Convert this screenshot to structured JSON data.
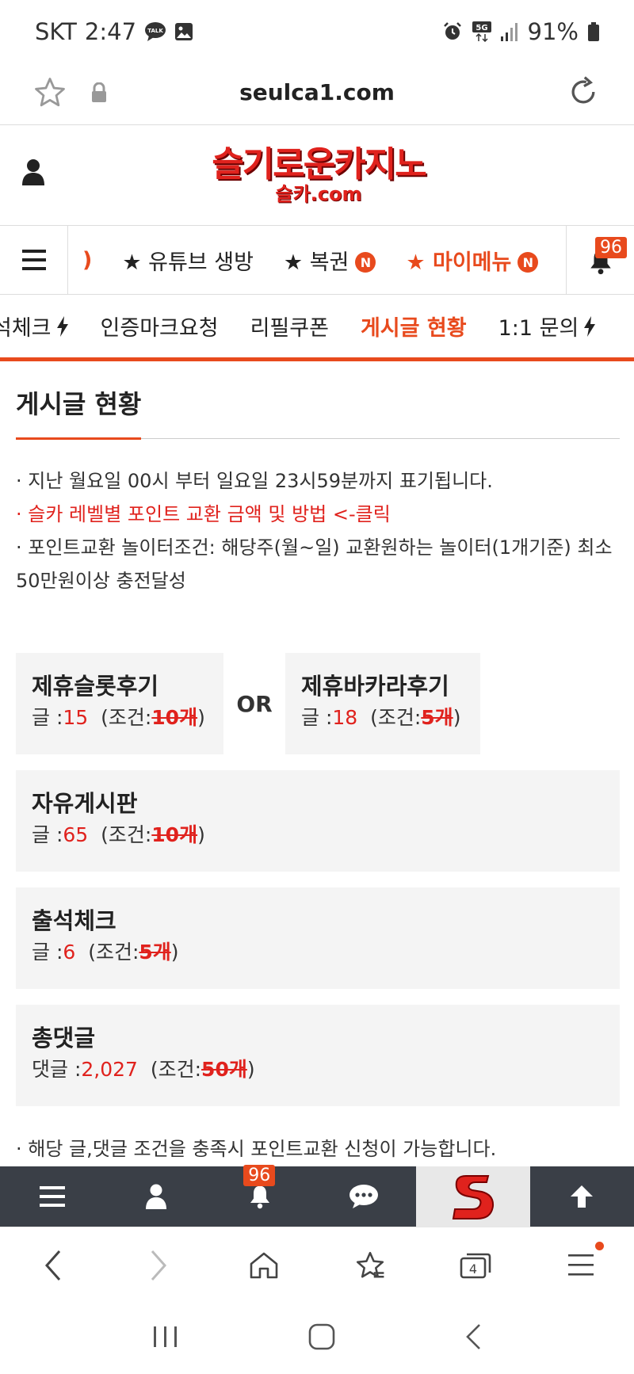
{
  "status_bar": {
    "carrier": "SKT",
    "time": "2:47",
    "battery": "91%"
  },
  "url_bar": {
    "url": "seulca1.com"
  },
  "header": {
    "logo_main": "슬기로운카지노",
    "logo_sub": "슬카.com"
  },
  "main_nav": {
    "items": [
      {
        "label": "★ 유튜브 생방",
        "badge": ""
      },
      {
        "label": "★ 복권",
        "badge": "N"
      },
      {
        "label": "★ 마이메뉴",
        "badge": "N"
      }
    ],
    "notification_count": "96"
  },
  "sub_nav": {
    "items": [
      "석체크",
      "인증마크요청",
      "리필쿠폰",
      "게시글 현황",
      "1:1 문의"
    ]
  },
  "page": {
    "title": "게시글 현황",
    "notes": [
      "· 지난 월요일 00시 부터 일요일 23시59분까지 표기됩니다.",
      "· 슬카 레벨별 포인트 교환 금액 및 방법 <-클릭",
      "· 포인트교환 놀이터조건: 해당주(월~일) 교환원하는 놀이터(1개기준) 최소50만원이상 충전달성"
    ],
    "or_label": "OR",
    "cards": [
      {
        "title": "제휴슬롯후기",
        "label": "글 :",
        "value": "15",
        "cond_prefix": "(조건:",
        "cond_value": "10개",
        "cond_suffix": ")"
      },
      {
        "title": "제휴바카라후기",
        "label": "글 :",
        "value": "18",
        "cond_prefix": "(조건:",
        "cond_value": "5개",
        "cond_suffix": ")"
      },
      {
        "title": "자유게시판",
        "label": "글 :",
        "value": "65",
        "cond_prefix": "(조건:",
        "cond_value": "10개",
        "cond_suffix": ")"
      },
      {
        "title": "출석체크",
        "label": "글 :",
        "value": "6",
        "cond_prefix": "(조건:",
        "cond_value": "5개",
        "cond_suffix": ")"
      },
      {
        "title": "총댓글",
        "label": "댓글 :",
        "value": "2,027",
        "cond_prefix": "(조건:",
        "cond_value": "50개",
        "cond_suffix": ")"
      }
    ],
    "footer_note": "· 해당 글,댓글 조건을 충족시 포인트교환 신청이 가능합니다."
  },
  "app_bar": {
    "notification_count": "96"
  },
  "browser_bar": {
    "tab_count": "4"
  },
  "colors": {
    "accent": "#e84a1d",
    "red_text": "#e0221d",
    "app_bar_bg": "#3a3f47",
    "card_bg": "#f4f4f4"
  },
  "icons": [
    "star-icon",
    "lock-icon",
    "reload-icon",
    "user-icon",
    "menu-icon",
    "bell-icon",
    "bolt-icon",
    "chat-icon",
    "arrow-up-icon",
    "back-icon",
    "forward-icon",
    "home-icon",
    "bookmark-icon",
    "tabs-icon"
  ]
}
